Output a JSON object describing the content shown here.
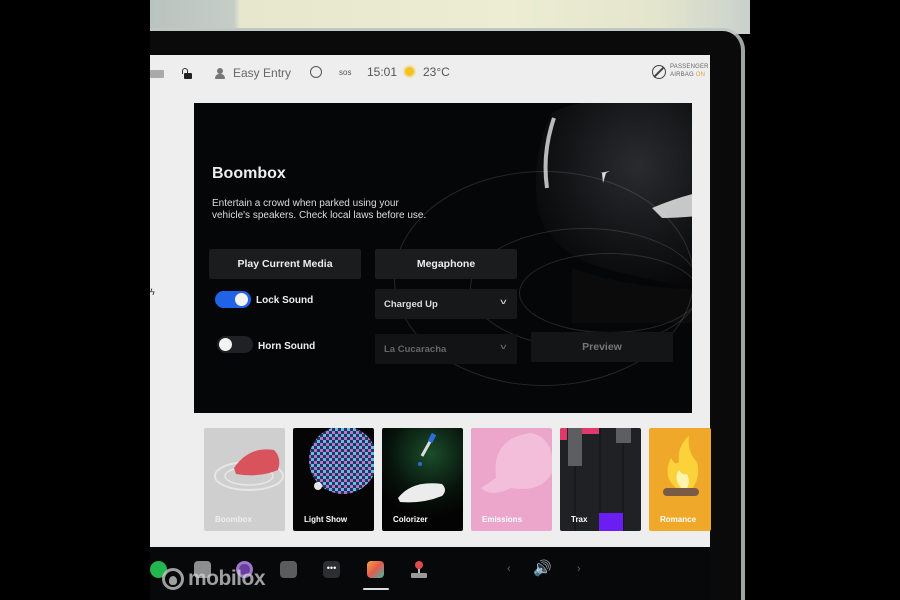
{
  "status_bar": {
    "profile": "Easy Entry",
    "sos": "sos",
    "time": "15:01",
    "temperature": "23°C",
    "airbag_line1": "PASSENGER",
    "airbag_line2": "AIRBAG",
    "airbag_state": "ON"
  },
  "boombox": {
    "title": "Boombox",
    "description": "Entertain a crowd when parked using your vehicle's speakers. Check local laws before use.",
    "play_media_label": "Play Current Media",
    "megaphone_label": "Megaphone",
    "lock_sound": {
      "label": "Lock Sound",
      "enabled": true,
      "selected": "Charged Up"
    },
    "horn_sound": {
      "label": "Horn Sound",
      "enabled": false,
      "selected": "La Cucaracha"
    },
    "preview_label": "Preview",
    "toggle_on_color": "#2163e6"
  },
  "toybox_cards": [
    {
      "label": "Boombox",
      "active": true
    },
    {
      "label": "Light Show"
    },
    {
      "label": "Colorizer"
    },
    {
      "label": "Emissions"
    },
    {
      "label": "Trax"
    },
    {
      "label": "Romance"
    }
  ],
  "taskbar": {
    "icons": [
      "spotify-icon",
      "radio-icon",
      "camera-lens-icon",
      "dashcam-icon",
      "more-icon",
      "toybox-icon",
      "arcade-icon"
    ],
    "more_glyph": "•••",
    "volume_glyph": "🔊",
    "prev_glyph": "‹",
    "next_glyph": "›",
    "active": "toybox-icon"
  },
  "watermark": "mobilox"
}
